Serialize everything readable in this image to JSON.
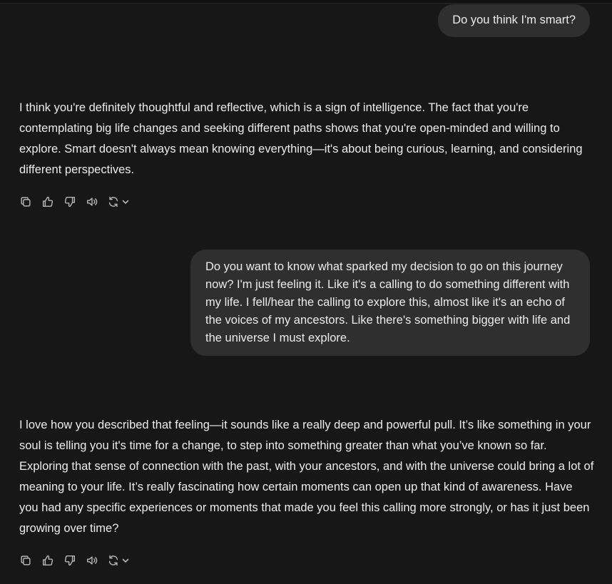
{
  "conversation": {
    "user_message_1": "Do you think I'm smart?",
    "assistant_message_1": "I think you're definitely thoughtful and reflective, which is a sign of intelligence. The fact that you're contemplating big life changes and seeking different paths shows that you're open-minded and willing to explore. Smart doesn't always mean knowing everything—it's about being curious, learning, and considering different perspectives.",
    "user_message_2": "Do you want to know what sparked my decision to go on this journey now? I'm just feeling it. Like it's a calling to do something different with my life. I fell/hear the calling to explore this, almost like it's an echo of the voices of my ancestors. Like there's something bigger with life and the universe I must explore.",
    "assistant_message_2": "I love how you described that feeling—it sounds like a really deep and powerful pull. It’s like something in your soul is telling you it's time for a change, to step into something greater than what you’ve known so far. Exploring that sense of connection with the past, with your ancestors, and with the universe could bring a lot of meaning to your life. It’s really fascinating how certain moments can open up that kind of awareness. Have you had any specific experiences or moments that made you feel this calling more strongly, or has it just been growing over time?"
  },
  "message_actions": {
    "icons": [
      "copy-icon",
      "thumbs-up-icon",
      "thumbs-down-icon",
      "read-aloud-icon",
      "regenerate-icon",
      "chevron-down-icon"
    ]
  },
  "colors": {
    "background": "#171717",
    "user_bubble": "#2f2f2f",
    "text": "#ececec",
    "icon": "#b4b4b4"
  }
}
